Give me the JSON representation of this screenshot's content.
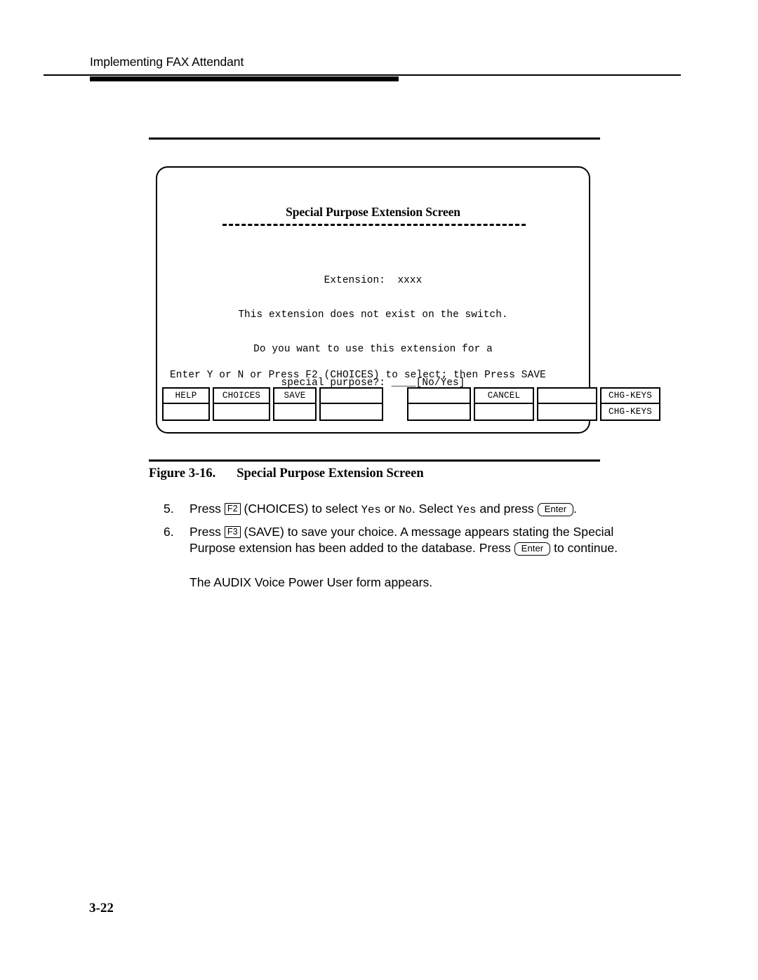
{
  "page": {
    "running_header": "Implementing FAX Attendant",
    "folio": "3-22"
  },
  "figure": {
    "caption_label": "Figure 3-16.",
    "caption_title": "Special Purpose Extension Screen",
    "terminal": {
      "title": "Special Purpose Extension Screen",
      "body_lines": [
        "Extension:  xxxx",
        "This extension does not exist on the switch.",
        "Do you want to use this extension for a",
        "special purpose?: ____[No/Yes]"
      ],
      "field_label": "Extension:",
      "field_value": "xxxx",
      "input_field_value": "____",
      "input_choices": "[No/Yes]",
      "prompt": "Enter Y or N or Press F2 (CHOICES) to select; then Press SAVE",
      "function_keys": [
        {
          "top": "HELP",
          "bottom": ""
        },
        {
          "top": "CHOICES",
          "bottom": ""
        },
        {
          "top": "SAVE",
          "bottom": ""
        },
        {
          "top": "",
          "bottom": ""
        },
        {
          "top": "",
          "bottom": ""
        },
        {
          "top": "CANCEL",
          "bottom": ""
        },
        {
          "top": "",
          "bottom": ""
        },
        {
          "top": "CHG-KEYS",
          "bottom": "CHG-KEYS"
        }
      ]
    }
  },
  "steps": [
    {
      "number": "5.",
      "segments": [
        {
          "type": "text",
          "value": "Press "
        },
        {
          "type": "keycap-square",
          "value": "F2"
        },
        {
          "type": "text",
          "value": " (CHOICES) to select "
        },
        {
          "type": "mono",
          "value": "Yes"
        },
        {
          "type": "text",
          "value": " or "
        },
        {
          "type": "mono",
          "value": "No"
        },
        {
          "type": "text",
          "value": ".  Select "
        },
        {
          "type": "mono",
          "value": "Yes"
        },
        {
          "type": "text",
          "value": " and press "
        },
        {
          "type": "keycap-round",
          "value": "Enter"
        },
        {
          "type": "text",
          "value": "."
        }
      ]
    },
    {
      "number": "6.",
      "segments": [
        {
          "type": "text",
          "value": "Press "
        },
        {
          "type": "keycap-square",
          "value": "F3"
        },
        {
          "type": "text",
          "value": " (SAVE) to save your choice.  A message appears stating the Special Purpose extension has been added to the database. Press "
        },
        {
          "type": "keycap-round",
          "value": "Enter"
        },
        {
          "type": "text",
          "value": " to continue."
        }
      ]
    }
  ],
  "closing_paragraph": "The AUDIX Voice Power User form appears.",
  "colors": {
    "ink": "#000000",
    "paper": "#ffffff"
  }
}
